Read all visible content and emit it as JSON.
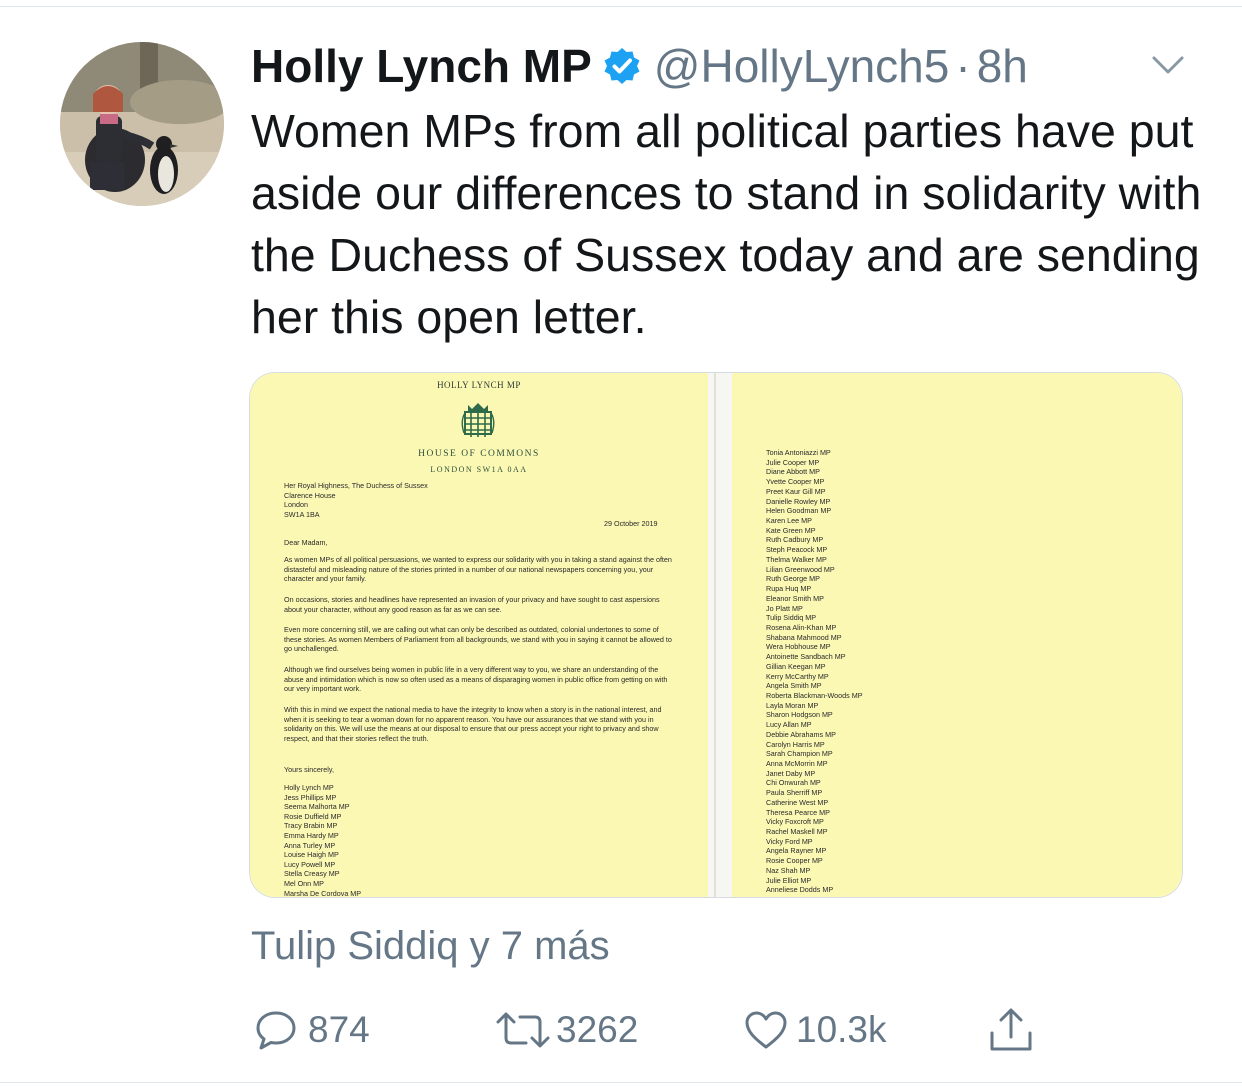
{
  "tweet": {
    "author_name": "Holly Lynch MP",
    "handle": "@HollyLynch5",
    "separator": "·",
    "time": "8h",
    "verified": true,
    "text": "Women MPs from all political parties have put aside our differences to stand in solidarity with the Duchess of Sussex today and are sending her this open letter.",
    "liked_by": "Tulip Siddiq y 7 más",
    "colors": {
      "text": "#14171a",
      "secondary": "#657786",
      "verified": "#1da1f2",
      "paper": "#fbf8b4"
    }
  },
  "letter": {
    "letterhead": "HOLLY LYNCH MP",
    "institution": "HOUSE OF COMMONS",
    "address_line": "LONDON SW1A 0AA",
    "recipient": [
      "Her Royal Highness, The Duchess of Sussex",
      "Clarence House",
      "London",
      "SW1A 1BA"
    ],
    "date": "29 October 2019",
    "salutation": "Dear Madam,",
    "paragraphs": [
      "As women MPs of all political persuasions, we wanted to express our solidarity with you in taking a stand against the often distasteful and misleading nature of the stories printed in a number of our national newspapers concerning you, your character and your family.",
      "On occasions, stories and headlines have represented an invasion of your privacy and have sought to cast aspersions about your character, without any good reason as far as we can see.",
      "Even more concerning still, we are calling out what can only be described as outdated, colonial undertones to some of these stories. As women Members of Parliament from all backgrounds, we stand with you in saying it cannot be allowed to go unchallenged.",
      "Although we find ourselves being women in public life in a very different way to you, we share an understanding of the abuse and intimidation which is now so often used as a means of disparaging women in public office from getting on with our very important work.",
      "With this in mind we expect the national media to have the integrity to know when a story is in the national interest, and when it is seeking to tear a woman down for no apparent reason. You have our assurances that we stand with you in solidarity on this. We will use the means at our disposal to ensure that our press accept your right to privacy and show respect, and that their stories reflect the truth."
    ],
    "closing": "Yours sincerely,",
    "signatories_page1": [
      "Holly Lynch MP",
      "Jess Phillips MP",
      "Seema Malhorta MP",
      "Rosie Duffield MP",
      "Tracy Brabin MP",
      "Emma Hardy MP",
      "Anna Turley MP",
      "Louise Haigh MP",
      "Lucy Powell MP",
      "Stella Creasy MP",
      "Mel Onn MP",
      "Marsha De Cordova MP"
    ],
    "signatories_page2": [
      "Tonia Antoniazzi MP",
      "Julie Cooper MP",
      "Diane Abbott MP",
      "Yvette Cooper MP",
      "Preet Kaur Gill MP",
      "Danielle Rowley MP",
      "Helen Goodman MP",
      "Karen Lee MP",
      "Kate Green MP",
      "Ruth Cadbury MP",
      "Steph Peacock MP",
      "Thelma Walker MP",
      "Lilian Greenwood MP",
      "Ruth George MP",
      "Rupa Huq MP",
      "Eleanor Smith MP",
      "Jo Platt MP",
      "Tulip Siddiq MP",
      "Rosena Alin-Khan MP",
      "Shabana Mahmood MP",
      "Wera Hobhouse MP",
      "Antoinette Sandbach MP",
      "Gillian Keegan MP",
      "Kerry McCarthy MP",
      "Angela Smith MP",
      "Roberta Blackman-Woods MP",
      "Layla Moran MP",
      "Sharon Hodgson MP",
      "Lucy Allan MP",
      "Debbie Abrahams MP",
      "Carolyn Harris MP",
      "Sarah Champion MP",
      "Anna McMorrin MP",
      "Janet Daby MP",
      "Chi Onwurah MP",
      "Paula Sherriff MP",
      "Catherine West MP",
      "Theresa Pearce MP",
      "Vicky Foxcroft MP",
      "Rachel Maskell MP",
      "Vicky Ford MP",
      "Angela Rayner MP",
      "Rosie Cooper MP",
      "Naz Shah MP",
      "Julie Elliot MP",
      "Anneliese Dodds MP"
    ]
  },
  "actions": {
    "replies": "874",
    "retweets": "3262",
    "likes": "10.3k",
    "icons": [
      "reply-icon",
      "retweet-icon",
      "heart-icon",
      "share-icon"
    ]
  }
}
